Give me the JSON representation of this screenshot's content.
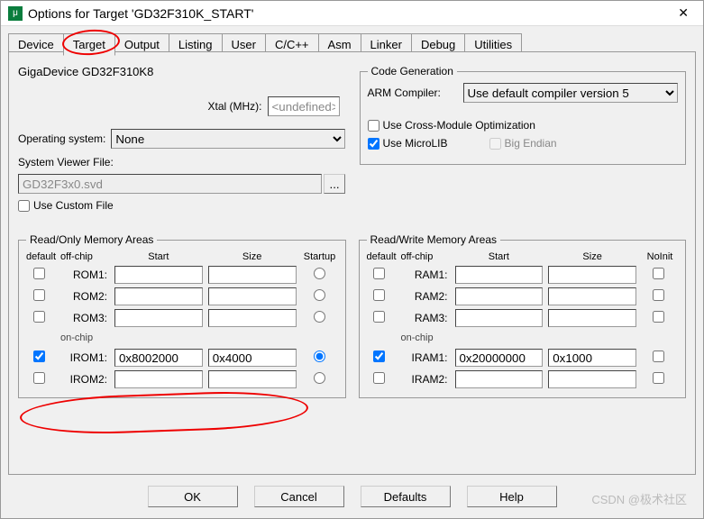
{
  "window": {
    "title": "Options for Target 'GD32F310K_START'"
  },
  "tabs": [
    "Device",
    "Target",
    "Output",
    "Listing",
    "User",
    "C/C++",
    "Asm",
    "Linker",
    "Debug",
    "Utilities"
  ],
  "activeTab": 1,
  "device_name": "GigaDevice GD32F310K8",
  "xtal": {
    "label": "Xtal (MHz):",
    "value": "<undefined>"
  },
  "os": {
    "label": "Operating system:",
    "value": "None"
  },
  "sysviewer": {
    "label": "System Viewer File:",
    "value": "GD32F3x0.svd",
    "browse": "..."
  },
  "use_custom_file": {
    "label": "Use Custom File",
    "checked": false
  },
  "codegen": {
    "legend": "Code Generation",
    "compiler_label": "ARM Compiler:",
    "compiler_value": "Use default compiler version 5",
    "cross": {
      "label": "Use Cross-Module Optimization",
      "checked": false
    },
    "microlib": {
      "label": "Use MicroLIB",
      "checked": true
    },
    "bigendian": {
      "label": "Big Endian",
      "checked": false
    }
  },
  "mem_ro": {
    "legend": "Read/Only Memory Areas",
    "hdr": {
      "default": "default",
      "offchip": "off-chip",
      "start": "Start",
      "size": "Size",
      "startup": "Startup"
    },
    "rows": [
      {
        "label": "ROM1:",
        "def": false,
        "start": "",
        "size": "",
        "startup": false
      },
      {
        "label": "ROM2:",
        "def": false,
        "start": "",
        "size": "",
        "startup": false
      },
      {
        "label": "ROM3:",
        "def": false,
        "start": "",
        "size": "",
        "startup": false
      }
    ],
    "onchip_label": "on-chip",
    "onchip": [
      {
        "label": "IROM1:",
        "def": true,
        "start": "0x8002000",
        "size": "0x4000",
        "startup": true
      },
      {
        "label": "IROM2:",
        "def": false,
        "start": "",
        "size": "",
        "startup": false
      }
    ]
  },
  "mem_rw": {
    "legend": "Read/Write Memory Areas",
    "hdr": {
      "default": "default",
      "offchip": "off-chip",
      "start": "Start",
      "size": "Size",
      "noinit": "NoInit"
    },
    "rows": [
      {
        "label": "RAM1:",
        "def": false,
        "start": "",
        "size": "",
        "noinit": false
      },
      {
        "label": "RAM2:",
        "def": false,
        "start": "",
        "size": "",
        "noinit": false
      },
      {
        "label": "RAM3:",
        "def": false,
        "start": "",
        "size": "",
        "noinit": false
      }
    ],
    "onchip_label": "on-chip",
    "onchip": [
      {
        "label": "IRAM1:",
        "def": true,
        "start": "0x20000000",
        "size": "0x1000",
        "noinit": false
      },
      {
        "label": "IRAM2:",
        "def": false,
        "start": "",
        "size": "",
        "noinit": false
      }
    ]
  },
  "buttons": {
    "ok": "OK",
    "cancel": "Cancel",
    "defaults": "Defaults",
    "help": "Help"
  },
  "watermark": "CSDN @极术社区"
}
